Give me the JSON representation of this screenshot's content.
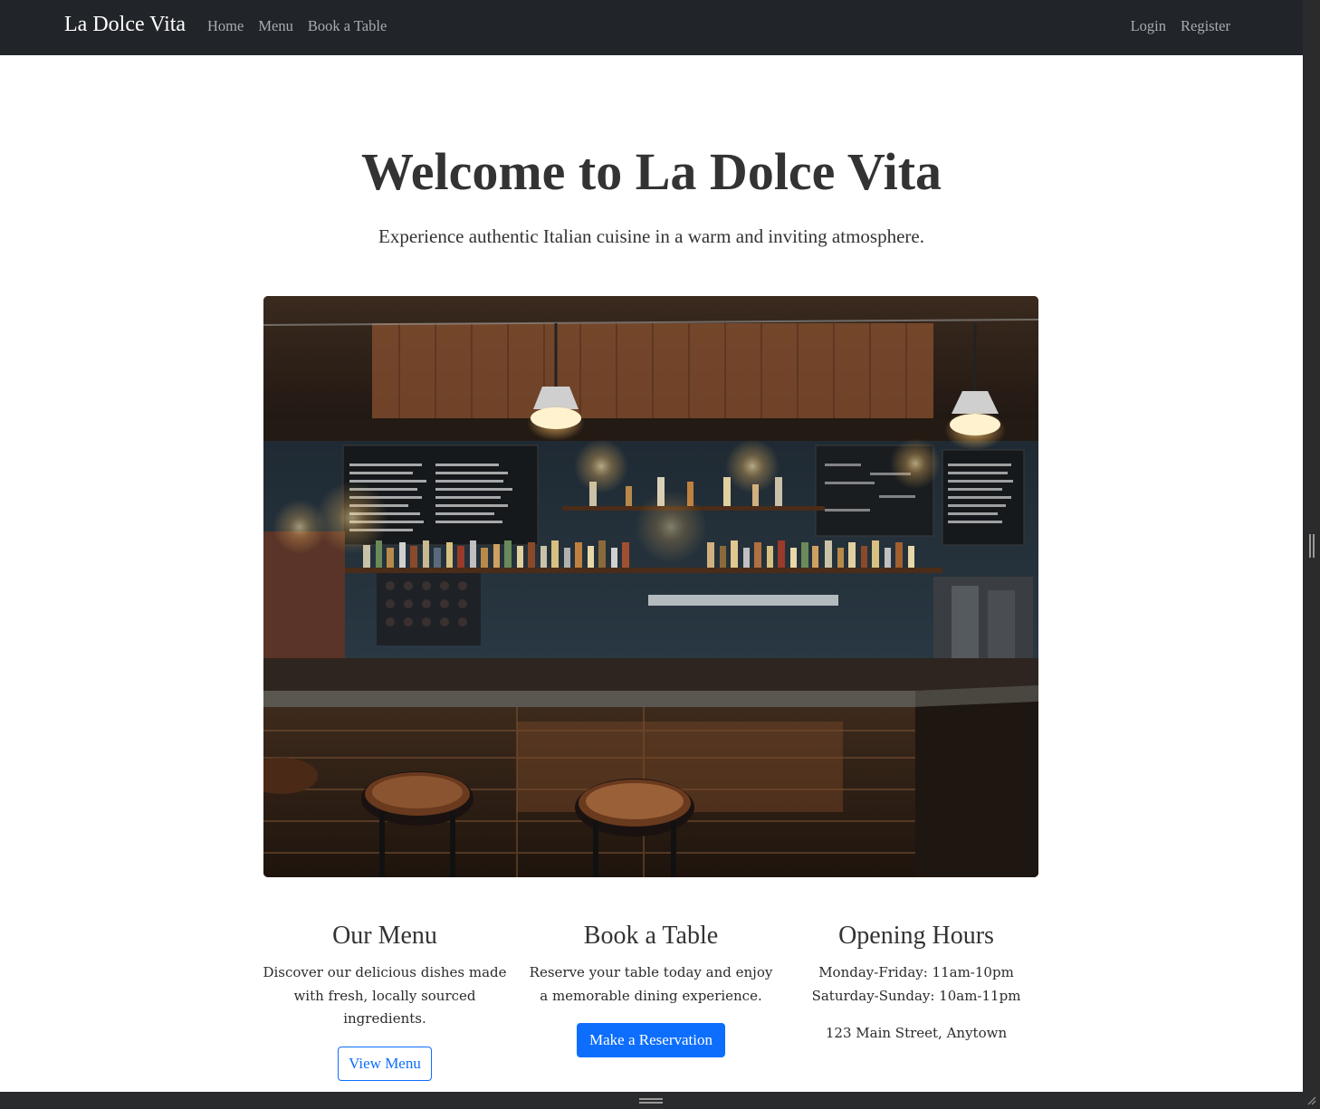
{
  "navbar": {
    "brand": "La Dolce Vita",
    "links": [
      "Home",
      "Menu",
      "Book a Table"
    ],
    "auth": [
      "Login",
      "Register"
    ]
  },
  "hero": {
    "title": "Welcome to La Dolce Vita",
    "subtitle": "Experience authentic Italian cuisine in a warm and inviting atmosphere.",
    "image_alt": "restaurant-bar-interior"
  },
  "sections": {
    "menu": {
      "title": "Our Menu",
      "text": "Discover our delicious dishes made with fresh, locally sourced ingredients.",
      "button": "View Menu"
    },
    "book": {
      "title": "Book a Table",
      "text": "Reserve your table today and enjoy a memorable dining experience.",
      "button": "Make a Reservation"
    },
    "hours": {
      "title": "Opening Hours",
      "weekdays": "Monday-Friday: 11am-10pm",
      "weekend": "Saturday-Sunday: 10am-11pm",
      "address": "123 Main Street, Anytown"
    }
  },
  "colors": {
    "navbar_bg": "#212529",
    "nav_link": "#a8abaf",
    "primary": "#0d6efd",
    "text": "#333333"
  }
}
